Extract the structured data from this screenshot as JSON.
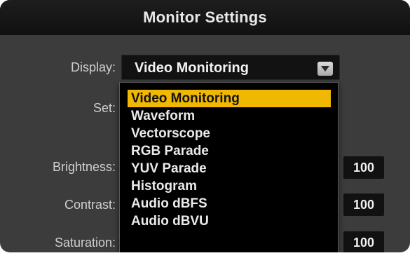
{
  "title": "Monitor Settings",
  "display": {
    "label": "Display:",
    "value": "Video Monitoring",
    "options": [
      "Video Monitoring",
      "Waveform",
      "Vectorscope",
      "RGB Parade",
      "YUV Parade",
      "Histogram",
      "Audio dBFS",
      "Audio dBVU"
    ],
    "selected_index": 0
  },
  "set": {
    "label": "Set:"
  },
  "brightness": {
    "label": "Brightness:",
    "value": "100"
  },
  "contrast": {
    "label": "Contrast:",
    "value": "100"
  },
  "saturation": {
    "label": "Saturation:",
    "value": "100"
  },
  "colors": {
    "highlight": "#f0b800"
  },
  "icons": {
    "dropdown": "chevron-down-icon"
  }
}
